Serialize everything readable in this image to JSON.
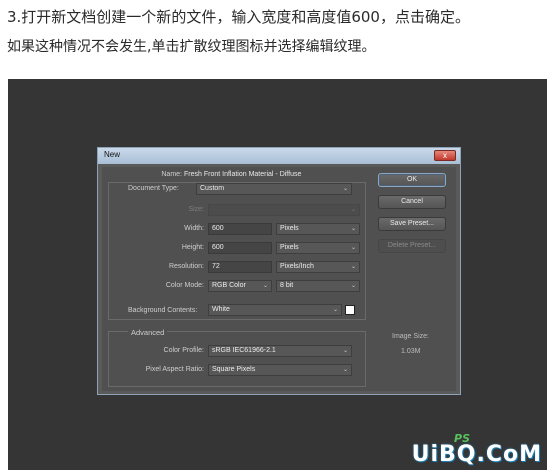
{
  "instructions": {
    "line1": "3.打开新文档创建一个新的文件，输入宽度和高度值600，点击确定。",
    "line2": "如果这种情况不会发生,单击扩散纹理图标并选择编辑纹理。"
  },
  "dialog": {
    "title": "New",
    "close_glyph": "x",
    "name_label": "Name:",
    "name_value": "Fresh Front Inflation Material - Diffuse",
    "document_type_label": "Document Type:",
    "document_type_value": "Custom",
    "size_label": "Size:",
    "width_label": "Width:",
    "width_value": "600",
    "width_unit": "Pixels",
    "height_label": "Height:",
    "height_value": "600",
    "height_unit": "Pixels",
    "resolution_label": "Resolution:",
    "resolution_value": "72",
    "resolution_unit": "Pixels/Inch",
    "color_mode_label": "Color Mode:",
    "color_mode_value": "RGB Color",
    "bit_depth_value": "8 bit",
    "background_label": "Background Contents:",
    "background_value": "White",
    "background_color": "#ffffff",
    "advanced_label": "Advanced",
    "color_profile_label": "Color Profile:",
    "color_profile_value": "sRGB IEC61966-2.1",
    "pixel_aspect_label": "Pixel Aspect Ratio:",
    "pixel_aspect_value": "Square Pixels",
    "buttons": {
      "ok": "OK",
      "cancel": "Cancel",
      "save_preset": "Save Preset...",
      "delete_preset": "Delete Preset..."
    },
    "image_size_label": "Image Size:",
    "image_size_value": "1.03M"
  },
  "watermark": {
    "text": "UiBQ.CoM",
    "ps_text": "PS"
  }
}
